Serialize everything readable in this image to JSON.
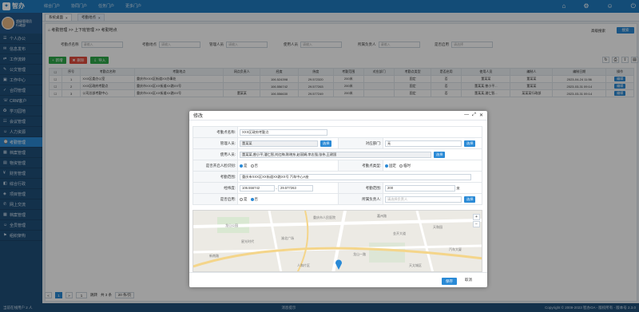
{
  "app": {
    "title": "智办",
    "nav": [
      "综合门户",
      "协同门户",
      "任务门户",
      "更多门户"
    ]
  },
  "user": {
    "name": "超级管理员",
    "role": "行政部"
  },
  "sidebar": {
    "items": [
      "个人办公",
      "信息发布",
      "工作流转",
      "公文管理",
      "工作中心",
      "合同管理",
      "CRM客户",
      "学习园地",
      "会议管理",
      "人力资源",
      "考勤管理",
      "档案管理",
      "物资管理",
      "财务管理",
      "综合行政",
      "项目管理",
      "网上交流",
      "档案管理",
      "全员管理",
      "组织架构"
    ],
    "active_index": 10
  },
  "tabs": [
    {
      "label": "系统桌面"
    },
    {
      "label": "考勤地点"
    }
  ],
  "breadcrumb": "考勤管理 >> 上下班管理 >> 考勤地点",
  "search": {
    "advanced": "高级搜索",
    "button": "搜索"
  },
  "filters": [
    {
      "label": "考勤点名称",
      "placeholder": "请输入"
    },
    {
      "label": "考勤地点",
      "placeholder": "请输入"
    },
    {
      "label": "管理人员",
      "placeholder": "请输入"
    },
    {
      "label": "使用人员",
      "placeholder": "请输入"
    },
    {
      "label": "所属负责人",
      "placeholder": "请输入"
    },
    {
      "label": "是否启用",
      "placeholder": "请选择"
    }
  ],
  "toolbar": {
    "add": "新增",
    "delete": "删除",
    "import": "导入"
  },
  "table": {
    "headers": [
      "序号",
      "考勤点名称",
      "考勤地点",
      "网点负责人",
      "经度",
      "纬度",
      "考勤范围",
      "对应部门",
      "考勤点类型",
      "是否启用",
      "使用人员",
      "编制人",
      "编制日期",
      "操作"
    ],
    "rows": [
      [
        "1",
        "XXX区委办公室",
        "重庆市XXX区街道XX办事处",
        "",
        "106.524398",
        "29.572320",
        "200米",
        "",
        "固定",
        "否",
        "董某某",
        "董某某",
        "2023-04-24 11:56",
        "编辑"
      ],
      [
        "2",
        "XXX区政府考勤点",
        "重庆市XXX区XX街道XX路XX号",
        "",
        "106.556742",
        "29.577263",
        "200米",
        "",
        "固定",
        "否",
        "董某某,曾小平...",
        "董某某",
        "2023-03-31 09:14",
        "编辑"
      ],
      [
        "3",
        "公司总部考勤中心",
        "重庆市XXX区XX街道XX路XX号",
        "董某某",
        "106.556630",
        "29.577249",
        "200米",
        "",
        "固定",
        "否",
        "董某某,潘仁智...",
        "某某某行政部",
        "2023-03-31 09:14",
        "编辑"
      ]
    ]
  },
  "pager": {
    "first": "«",
    "page": "1",
    "next": "»",
    "goto": "跳转",
    "total": "共 3 条",
    "size": "20 条/页"
  },
  "footer": {
    "left": "当前在线用户 2 人",
    "center": "消息提示",
    "right": "Copyright © 2009-2023 智办OA - 版权所有 - 版本号 2.3.0"
  },
  "modal": {
    "title": "修改",
    "fields": {
      "name_label": "考勤点名称:",
      "name_value": "XXX区政府考勤点",
      "manager_label": "管理人员:",
      "manager_value": "董某某",
      "dept_label": "对应部门:",
      "dept_value": "无",
      "users_label": "使用人员:",
      "users_value": "董某某,曾小平,潘仁智,刘红梅,陈晓东,赵丽娟,李志强,张伟,王建国",
      "face_label": "是否开启人脸识别:",
      "face_yes": "是",
      "face_no": "否",
      "type_label": "考勤点类型:",
      "type_fixed": "固定",
      "type_temp": "临时",
      "location_label": "考勤范围:",
      "location_value": "重庆市XXX区XX街道XX路XX号 汽车中心A座",
      "coord_label": "经纬度:",
      "lng": "106.556742",
      "lat": "29.577263",
      "range_label": "考勤范围:",
      "range_value": "200",
      "range_unit": "米",
      "enabled_label": "是否启用:",
      "enabled_yes": "是",
      "enabled_no": "否",
      "owner_label": "所属负责人:",
      "owner_placeholder": "请选择负责人",
      "select": "选择"
    },
    "map_labels": [
      "重庆市人民医院",
      "龙山公园",
      "渝北广场",
      "嘉州路",
      "新南路",
      "金开大道",
      "天和园",
      "星光时代",
      "龙山一路",
      "汽车大厦",
      "人和片区",
      "天太城区"
    ],
    "save": "保存",
    "cancel": "取消"
  },
  "colors": {
    "primary": "#2a8ad6",
    "topbar": "#1f7bc1",
    "sidebar": "#1f4f7a",
    "add": "#2ea84a",
    "delete": "#e04b3c",
    "import": "#2ea84a"
  }
}
